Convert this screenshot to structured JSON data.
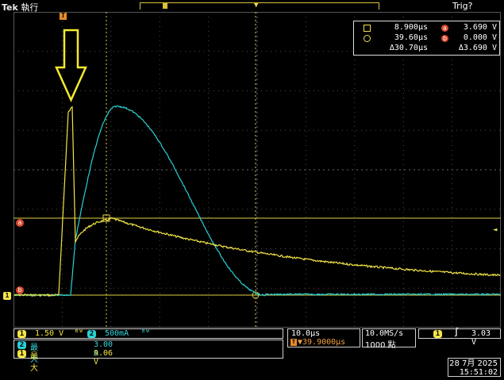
{
  "header": {
    "brand": "Tek",
    "state": "執行",
    "trigger_status": "Trig?"
  },
  "measurements": {
    "cursor1_time": "8.900µs",
    "cursor2_time": "39.60µs",
    "delta_time": "Δ30.70µs",
    "cursor_a_voltage": "3.690 V",
    "cursor_b_voltage": "0.000 V",
    "delta_voltage": "Δ3.690 V",
    "marker_a": "a",
    "marker_b": "b"
  },
  "channels": {
    "ch1_num": "1",
    "ch1_scale": "1.50 V",
    "ch2_num": "2",
    "ch2_scale": "500mA"
  },
  "readouts": [
    {
      "channel": "2",
      "label": "最大",
      "value": "3.00 A"
    },
    {
      "channel": "1",
      "label": "最大",
      "value": "9.06 V"
    }
  ],
  "timebase": {
    "scale": "10.0µs",
    "position": "▼39.9000µs",
    "trigger_marker": "T"
  },
  "acquisition": {
    "sample_rate": "10.0MS/s",
    "record_length": "1000 點"
  },
  "trigger": {
    "source": "1",
    "level": "3.03 V",
    "slope_symbol": "∫"
  },
  "datetime": {
    "date": "28 7月  2025",
    "time": "15:51:02"
  },
  "colors": {
    "ch1": "#f2e545",
    "ch2": "#28d1d4",
    "cursor": "#e0d040",
    "marker": "#d8472b"
  },
  "ground_marker": "1"
}
